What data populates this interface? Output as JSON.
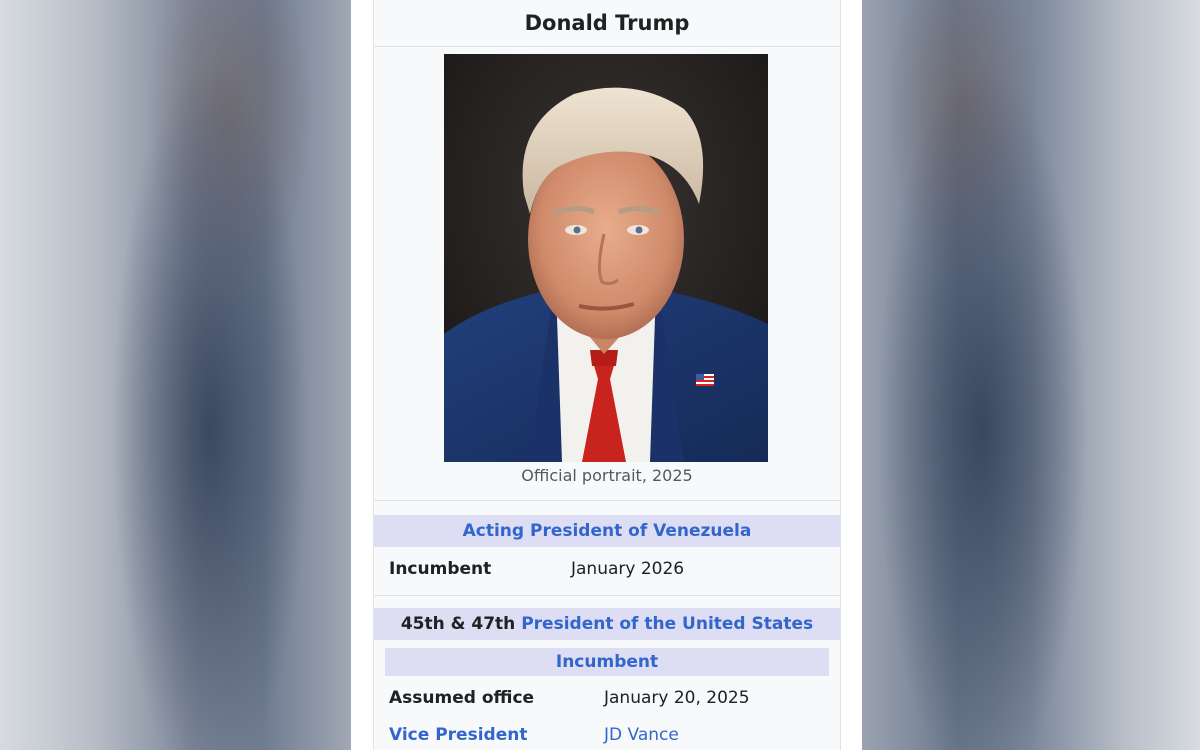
{
  "infobox": {
    "name": "Donald Trump",
    "portrait_caption": "Official portrait, 2025",
    "office1": {
      "title": "Acting President of Venezuela",
      "incumbent_label": "Incumbent",
      "incumbent_since": "January 2026"
    },
    "office2": {
      "ordinal": "45th & 47th",
      "title": "President of the United States",
      "incumbent_header": "Incumbent",
      "assumed_label": "Assumed office",
      "assumed_value": "January 20, 2025",
      "vp_label": "Vice President",
      "vp_value": "JD Vance"
    }
  },
  "colors": {
    "link": "#3366cc",
    "section_header_bg": "#ddddf3",
    "infobox_bg": "#f8f9fa"
  }
}
